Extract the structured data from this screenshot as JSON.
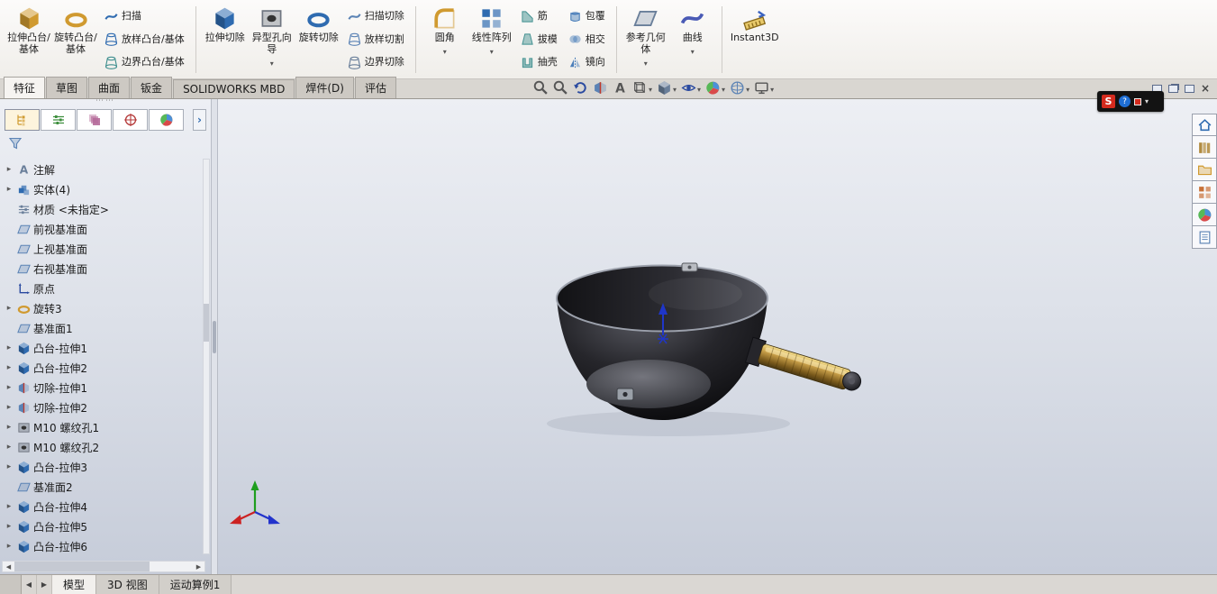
{
  "ribbon": {
    "groups": [
      {
        "large": [
          {
            "label": "拉伸凸台/基体",
            "icon": "extruded-boss-base",
            "dropdown": false
          },
          {
            "label": "旋转凸台/基体",
            "icon": "revolved-boss-base",
            "dropdown": false
          }
        ],
        "stacks": [
          [
            {
              "label": "扫描",
              "icon": "swept-boss-base"
            },
            {
              "label": "放样凸台/基体",
              "icon": "lofted-boss-base"
            },
            {
              "label": "边界凸台/基体",
              "icon": "boundary-boss-base"
            }
          ]
        ]
      },
      {
        "large": [
          {
            "label": "拉伸切除",
            "icon": "extruded-cut",
            "dropdown": false
          },
          {
            "label": "异型孔向导",
            "icon": "hole-wizard",
            "dropdown": true
          },
          {
            "label": "旋转切除",
            "icon": "revolved-cut",
            "dropdown": false
          }
        ],
        "stacks": [
          [
            {
              "label": "扫描切除",
              "icon": "swept-cut"
            },
            {
              "label": "放样切割",
              "icon": "lofted-cut"
            },
            {
              "label": "边界切除",
              "icon": "boundary-cut"
            }
          ]
        ]
      },
      {
        "large": [
          {
            "label": "圆角",
            "icon": "fillet",
            "dropdown": true
          },
          {
            "label": "线性阵列",
            "icon": "linear-pattern",
            "dropdown": true
          }
        ],
        "stacks": [
          [
            {
              "label": "筋",
              "icon": "rib"
            },
            {
              "label": "拔模",
              "icon": "draft"
            },
            {
              "label": "抽壳",
              "icon": "shell"
            }
          ],
          [
            {
              "label": "包覆",
              "icon": "wrap"
            },
            {
              "label": "相交",
              "icon": "intersect"
            },
            {
              "label": "镜向",
              "icon": "mirror"
            }
          ]
        ]
      },
      {
        "large": [
          {
            "label": "参考几何体",
            "icon": "reference-geometry",
            "dropdown": true
          },
          {
            "label": "曲线",
            "icon": "curves",
            "dropdown": true
          }
        ],
        "stacks": []
      },
      {
        "large": [
          {
            "label": "Instant3D",
            "icon": "instant3d",
            "dropdown": false
          }
        ],
        "stacks": []
      }
    ]
  },
  "command_tabs": {
    "tabs": [
      {
        "label": "特征",
        "active": true
      },
      {
        "label": "草图",
        "active": false
      },
      {
        "label": "曲面",
        "active": false
      },
      {
        "label": "钣金",
        "active": false
      },
      {
        "label": "SOLIDWORKS MBD",
        "active": false
      },
      {
        "label": "焊件(D)",
        "active": false
      },
      {
        "label": "评估",
        "active": false
      }
    ]
  },
  "view_toolbar": {
    "buttons": [
      {
        "name": "zoom-fit",
        "dropdown": false
      },
      {
        "name": "zoom-area",
        "dropdown": false
      },
      {
        "name": "previous-view",
        "dropdown": false
      },
      {
        "name": "section-view",
        "dropdown": false
      },
      {
        "name": "annotation-views",
        "dropdown": false
      },
      {
        "name": "view-orientation",
        "dropdown": true
      },
      {
        "name": "display-style",
        "dropdown": true
      },
      {
        "name": "hide-show-items",
        "dropdown": true
      },
      {
        "name": "edit-appearance",
        "dropdown": true
      },
      {
        "name": "apply-scene",
        "dropdown": true
      },
      {
        "name": "view-settings",
        "dropdown": true
      }
    ]
  },
  "window_controls": [
    "float-window",
    "tile-window",
    "restore-window",
    "close-window"
  ],
  "capture_badge": {
    "s_label": "S",
    "help_label": "?"
  },
  "feature_tree": {
    "panel_tabs": [
      "featuremanager-tree",
      "propertymanager",
      "configurationmanager",
      "dimxpertmanager",
      "displaymanager"
    ],
    "active_tab": "featuremanager-tree",
    "items": [
      {
        "label": "注解",
        "icon": "annotations",
        "expandable": true
      },
      {
        "label": "实体(4)",
        "icon": "solid-bodies-folder",
        "expandable": true
      },
      {
        "label": "材质 <未指定>",
        "icon": "material",
        "expandable": false
      },
      {
        "label": "前视基准面",
        "icon": "plane",
        "expandable": false
      },
      {
        "label": "上视基准面",
        "icon": "plane",
        "expandable": false
      },
      {
        "label": "右视基准面",
        "icon": "plane",
        "expandable": false
      },
      {
        "label": "原点",
        "icon": "origin",
        "expandable": false
      },
      {
        "label": "旋转3",
        "icon": "revolve-feature",
        "expandable": true
      },
      {
        "label": "基准面1",
        "icon": "plane",
        "expandable": false
      },
      {
        "label": "凸台-拉伸1",
        "icon": "boss-extrude",
        "expandable": true
      },
      {
        "label": "凸台-拉伸2",
        "icon": "boss-extrude",
        "expandable": true
      },
      {
        "label": "切除-拉伸1",
        "icon": "cut-extrude",
        "expandable": true
      },
      {
        "label": "切除-拉伸2",
        "icon": "cut-extrude",
        "expandable": true
      },
      {
        "label": "M10 螺纹孔1",
        "icon": "tapped-hole",
        "expandable": true
      },
      {
        "label": "M10 螺纹孔2",
        "icon": "tapped-hole",
        "expandable": true
      },
      {
        "label": "凸台-拉伸3",
        "icon": "boss-extrude",
        "expandable": true
      },
      {
        "label": "基准面2",
        "icon": "plane",
        "expandable": false
      },
      {
        "label": "凸台-拉伸4",
        "icon": "boss-extrude",
        "expandable": true
      },
      {
        "label": "凸台-拉伸5",
        "icon": "boss-extrude",
        "expandable": true
      },
      {
        "label": "凸台-拉伸6",
        "icon": "boss-extrude",
        "expandable": true
      }
    ]
  },
  "task_pane_icons": [
    "solidworks-resources-home",
    "design-library",
    "file-explorer",
    "view-palette",
    "appearances-scenes",
    "custom-properties"
  ],
  "bottom_bar": {
    "tabs": [
      {
        "label": "模型",
        "active": true
      },
      {
        "label": "3D 视图",
        "active": false
      },
      {
        "label": "运动算例1",
        "active": false
      }
    ]
  },
  "colors": {
    "accent_blue": "#2f6bb0",
    "gold": "#d09a30",
    "graphics_top": "#edeff4",
    "graphics_bottom": "#c6ccd9",
    "badge_red": "#d42b1e",
    "badge_blue": "#1e6ed4"
  }
}
